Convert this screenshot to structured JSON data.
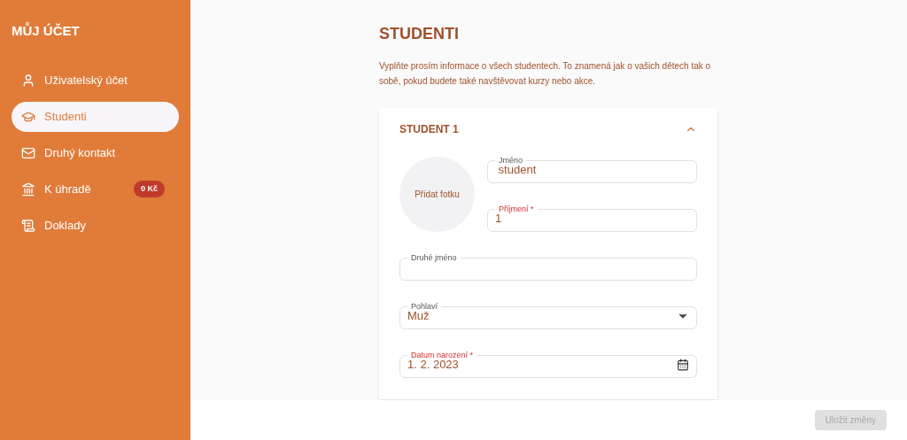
{
  "sidebar": {
    "title": "MŮJ ÚČET",
    "items": [
      {
        "label": "Uživatelský účet",
        "selected": false
      },
      {
        "label": "Studenti",
        "selected": true
      },
      {
        "label": "Druhý kontakt",
        "selected": false
      },
      {
        "label": "K úhradě",
        "selected": false,
        "badge": "0 Kč"
      },
      {
        "label": "Doklady",
        "selected": false
      }
    ]
  },
  "page": {
    "title": "STUDENTI",
    "intro": "Vyplňte prosím informace o všech studentech. To znamená jak o vašich dětech tak o sobě, pokud budete také navštěvovat kurzy nebo akce."
  },
  "student": {
    "title": "STUDENT 1",
    "expanded": true,
    "photo": "Přidat fotku",
    "fields": [
      {
        "kind": "text",
        "label": "Jméno",
        "value": " student",
        "required": false
      },
      {
        "kind": "text",
        "label": "Příjmení *",
        "value": "1",
        "required": true
      },
      {
        "kind": "text",
        "label": "Druhé jméno",
        "required": false
      },
      {
        "kind": "select",
        "label": "Pohlaví",
        "value": "Muž",
        "required": false
      },
      {
        "kind": "date",
        "label": "Datum narození *",
        "value": "1. 2. 2023",
        "required": true
      }
    ]
  },
  "footer": {
    "save": {
      "label": "Uložit změny",
      "disabled": true
    }
  }
}
